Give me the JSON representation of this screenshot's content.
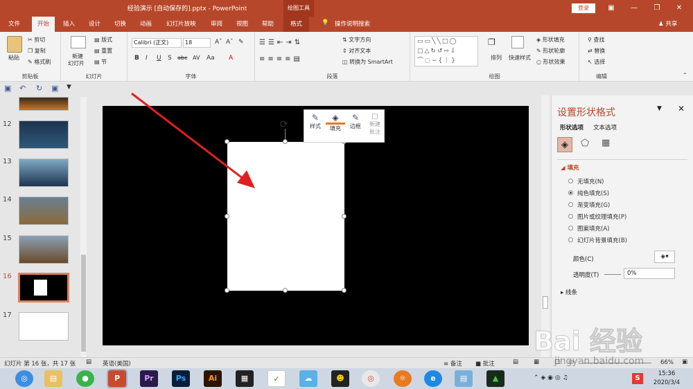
{
  "titlebar": {
    "title": "经验演示 [自动保存的].pptx  -  PowerPoint",
    "context_tab": "绘图工具",
    "login": "登录"
  },
  "tabs": [
    "文件",
    "开始",
    "插入",
    "设计",
    "切换",
    "动画",
    "幻灯片放映",
    "审阅",
    "视图",
    "帮助",
    "格式"
  ],
  "tell_me": "操作说明搜索",
  "share": "共享",
  "ribbon": {
    "clipboard": {
      "paste": "粘贴",
      "cut": "剪切",
      "copy": "复制",
      "format_painter": "格式刷",
      "label": "剪贴板"
    },
    "slides": {
      "new_slide_line1": "新建",
      "new_slide_line2": "幻灯片",
      "layout": "版式",
      "reset": "重置",
      "section": "节",
      "label": "幻灯片"
    },
    "font": {
      "font_name": "Calibri (正文)",
      "font_size": "18",
      "label": "字体"
    },
    "paragraph": {
      "text_direction": "文字方向",
      "align_text": "对齐文本",
      "smartart": "转换为 SmartArt",
      "label": "段落"
    },
    "drawing": {
      "arrange": "排列",
      "quick_styles": "快速样式",
      "shape_fill": "形状填充",
      "shape_outline": "形状轮廓",
      "shape_effects": "形状效果",
      "label": "绘图"
    },
    "editing": {
      "find": "查找",
      "replace": "替换",
      "select": "选择",
      "label": "编辑"
    }
  },
  "slide_numbers": [
    "12",
    "13",
    "14",
    "15",
    "16",
    "17"
  ],
  "active_slide": "16",
  "mini_toolbar": {
    "style": "样式",
    "fill": "填充",
    "border": "边框",
    "new_comment_line1": "新建",
    "new_comment_line2": "批注"
  },
  "pane": {
    "title": "设置形状格式",
    "tab_shape": "形状选项",
    "tab_text": "文本选项",
    "fill_section": "填充",
    "fill_options": [
      "无填充(N)",
      "纯色填充(S)",
      "渐变填充(G)",
      "图片或纹理填充(P)",
      "图案填充(A)",
      "幻灯片背景填充(B)"
    ],
    "selected_fill": 1,
    "color_label": "颜色(C)",
    "transparency_label": "透明度(T)",
    "transparency_value": "0%",
    "line_section": "线条"
  },
  "status": {
    "slide_info": "幻灯片 第 16 张，共 17 张",
    "language": "英语(美国)",
    "notes": "备注",
    "comments": "批注",
    "zoom": "66%"
  },
  "taskbar": {
    "time": "15:36",
    "date": "2020/3/4",
    "apps": [
      "Pr",
      "Ps",
      "Ai"
    ]
  },
  "watermark": {
    "text": "Bai 经验",
    "url": "jingyan.baidu.com"
  },
  "colors": {
    "accent": "#b7472a",
    "arrow": "#e02020"
  }
}
